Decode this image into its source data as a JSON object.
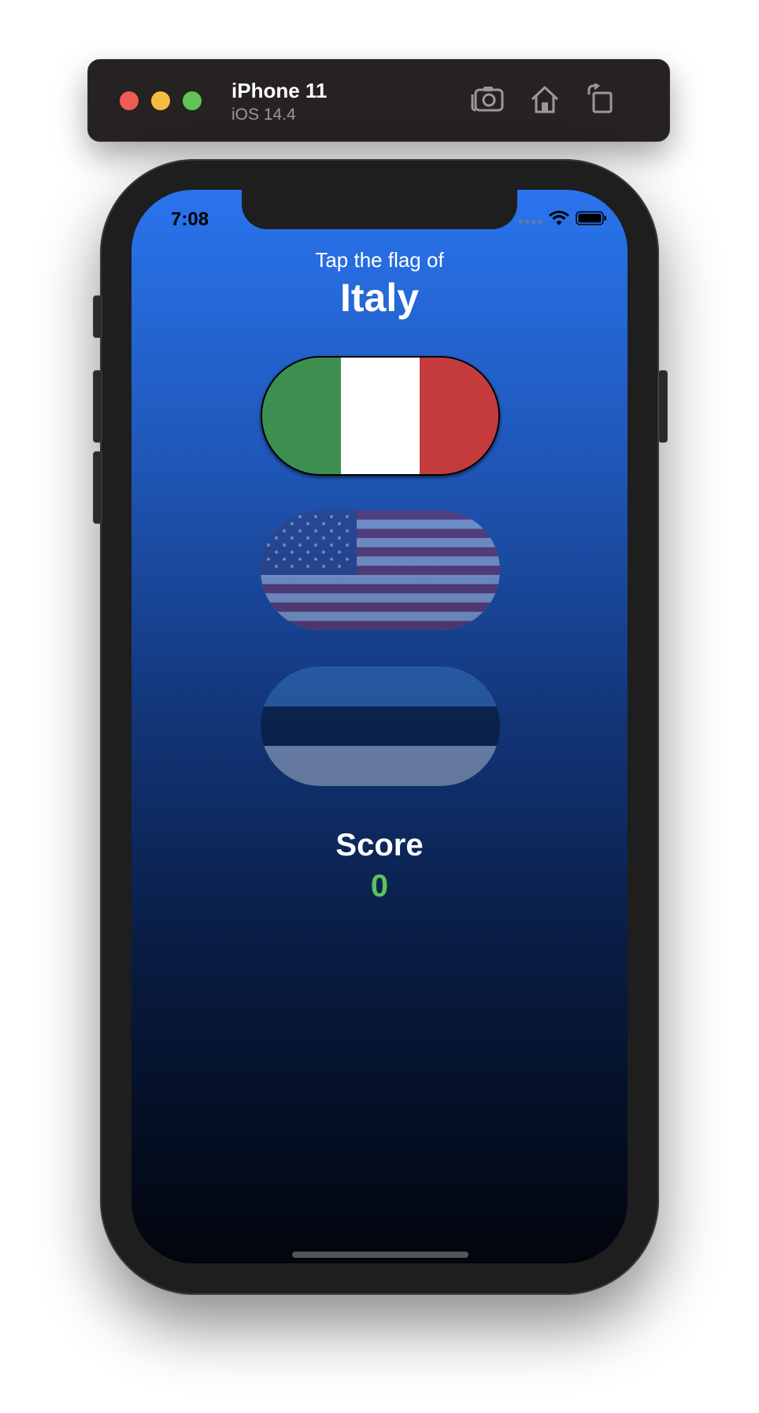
{
  "simulator": {
    "device_name": "iPhone 11",
    "os_version": "iOS 14.4",
    "icons": [
      "screenshot-icon",
      "home-icon",
      "rotate-icon"
    ]
  },
  "status_bar": {
    "time": "7:08",
    "icons": [
      "cellular-icon",
      "wifi-icon",
      "battery-icon"
    ]
  },
  "game": {
    "prompt": "Tap the flag of",
    "country": "Italy",
    "flags": [
      {
        "name": "Italy",
        "state": "highlighted"
      },
      {
        "name": "US",
        "state": "dimmed"
      },
      {
        "name": "Estonia",
        "state": "dimmed"
      }
    ],
    "score_label": "Score",
    "score_value": "0"
  },
  "colors": {
    "background_top": "#2a74ee",
    "background_bottom": "#02050c",
    "score_value": "#5cc45a",
    "italy_green": "#3d8f4f",
    "italy_red": "#c33b3d"
  }
}
